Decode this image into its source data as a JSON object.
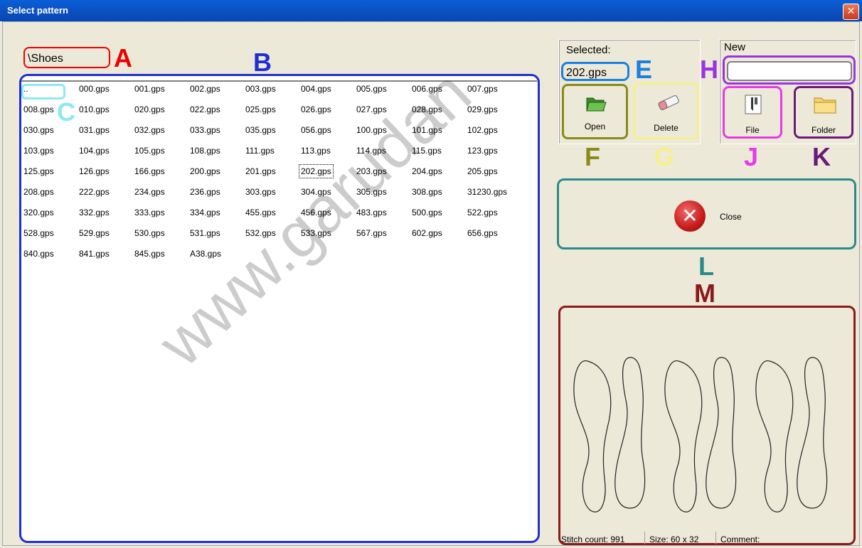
{
  "window": {
    "title": "Select pattern",
    "close_glyph": "✕"
  },
  "path": {
    "value": "\\Shoes"
  },
  "annotations": {
    "A": "A",
    "B": "B",
    "C": "C",
    "E": "E",
    "F": "F",
    "G": "G",
    "H": "H",
    "J": "J",
    "K": "K",
    "L": "L",
    "M": "M"
  },
  "files": {
    "up": "..",
    "rows": [
      [
        "..",
        "000.gps",
        "001.gps",
        "002.gps",
        "003.gps",
        "004.gps",
        "005.gps",
        "006.gps",
        "007.gps"
      ],
      [
        "008.gps",
        "010.gps",
        "020.gps",
        "022.gps",
        "025.gps",
        "026.gps",
        "027.gps",
        "028.gps",
        "029.gps"
      ],
      [
        "030.gps",
        "031.gps",
        "032.gps",
        "033.gps",
        "035.gps",
        "056.gps",
        "100.gps",
        "101.gps",
        "102.gps"
      ],
      [
        "103.gps",
        "104.gps",
        "105.gps",
        "108.gps",
        "111.gps",
        "113.gps",
        "114.gps",
        "115.gps",
        "123.gps"
      ],
      [
        "125.gps",
        "126.gps",
        "166.gps",
        "200.gps",
        "201.gps",
        "202.gps",
        "203.gps",
        "204.gps",
        "205.gps"
      ],
      [
        "208.gps",
        "222.gps",
        "234.gps",
        "236.gps",
        "303.gps",
        "304.gps",
        "305.gps",
        "308.gps",
        "31230.gps"
      ],
      [
        "320.gps",
        "332.gps",
        "333.gps",
        "334.gps",
        "455.gps",
        "456.gps",
        "483.gps",
        "500.gps",
        "522.gps"
      ],
      [
        "528.gps",
        "529.gps",
        "530.gps",
        "531.gps",
        "532.gps",
        "533.gps",
        "567.gps",
        "602.gps",
        "656.gps"
      ],
      [
        "840.gps",
        "841.gps",
        "845.gps",
        "A38.gps"
      ]
    ],
    "selected": "202.gps"
  },
  "selected_panel": {
    "label": "Selected:",
    "value": "202.gps"
  },
  "new_panel": {
    "label": "New",
    "value": ""
  },
  "buttons": {
    "open": "Open",
    "delete": "Delete",
    "file": "File",
    "folder": "Folder",
    "close": "Close"
  },
  "icons": {
    "open": "folder-open-icon",
    "delete": "eraser-icon",
    "file": "sewing-needle-icon",
    "folder": "folder-icon",
    "close": "red-x-icon"
  },
  "status": {
    "stitch_count": "Stitch count: 991",
    "size": "Size: 60 x 32",
    "comment": "Comment:"
  },
  "watermark": "www.garudan"
}
